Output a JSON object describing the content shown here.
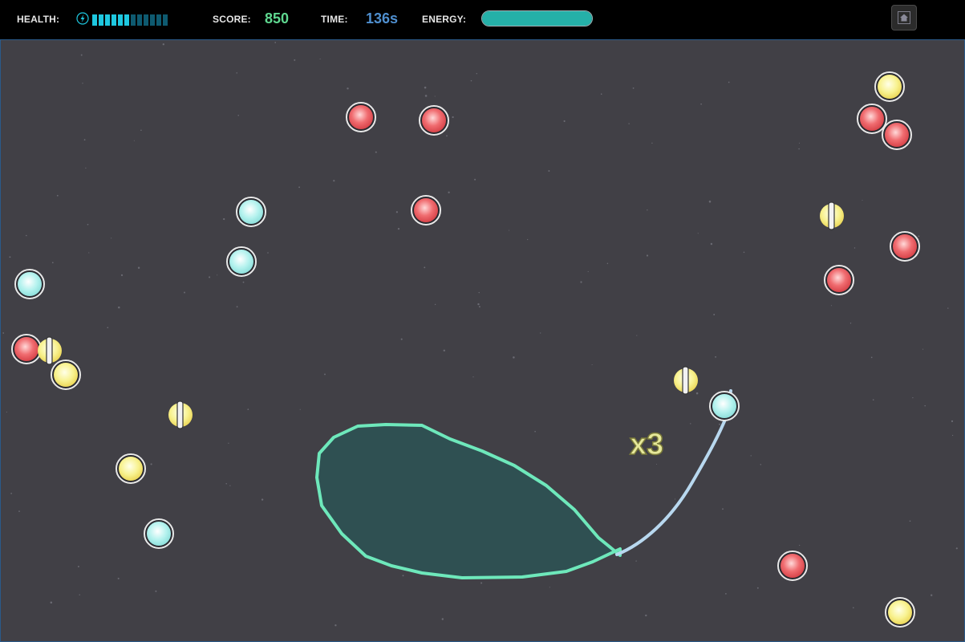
{
  "hud": {
    "health_label": "HEALTH:",
    "health_level": 0.5,
    "health_segments": 12,
    "health_icon": "lightning-icon",
    "score_label": "SCORE:",
    "score_value": "850",
    "time_label": "TIME:",
    "time_value": "136s",
    "energy_label": "ENERGY:",
    "energy_level": 1.0,
    "home_icon": "home-icon"
  },
  "colors": {
    "background": "#414046",
    "score": "#5fd890",
    "time": "#4f8fcf",
    "health_on": "#1ec8e0",
    "health_off": "#0e5a70",
    "energy": "#25b0a8",
    "lasso_fill": "#2f5052",
    "lasso_stroke": "#6ee8bb",
    "tail_stroke": "#b8d8ef",
    "multiplier": "#e6e89a"
  },
  "multiplier": "x3",
  "orb_types": [
    "red",
    "cyan",
    "yellow",
    "yellow-shielded"
  ]
}
